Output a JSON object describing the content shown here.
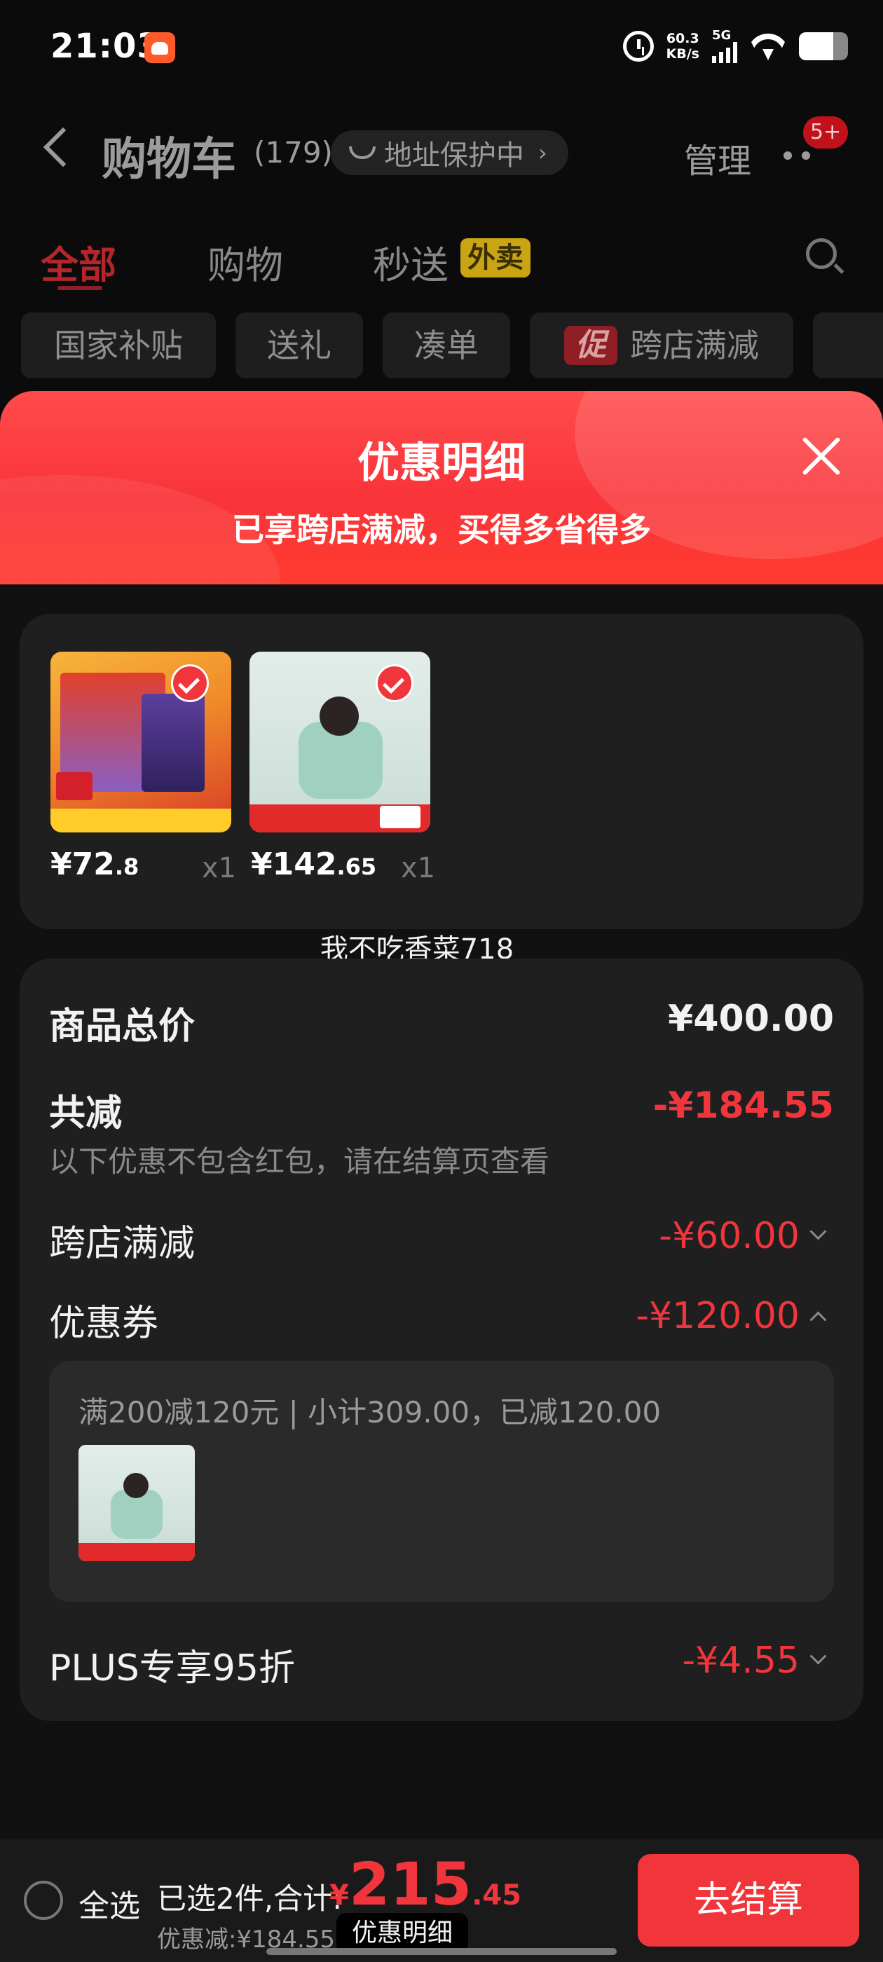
{
  "status_bar": {
    "time": "21:03",
    "net_speed_value": "60.3",
    "net_speed_unit": "KB/s",
    "network_type": "5G",
    "battery_level": 0.7
  },
  "header": {
    "title": "购物车",
    "count": "(179)",
    "address_protect": "地址保护中",
    "manage": "管理",
    "notification_badge": "5+"
  },
  "tabs": [
    {
      "label": "全部",
      "active": true
    },
    {
      "label": "购物",
      "active": false
    },
    {
      "label": "秒送",
      "active": false
    }
  ],
  "waimai_tag": "外卖",
  "filters": {
    "chips": [
      "国家补贴",
      "送礼",
      "凑单"
    ],
    "promo_tag": "促",
    "promo_chip": "跨店满减"
  },
  "sheet": {
    "title": "优惠明细",
    "subtitle": "已享跨店满减，买得多省得多"
  },
  "products": [
    {
      "price_int": "¥72",
      "price_dec": ".8",
      "qty": "x1"
    },
    {
      "price_int": "¥142",
      "price_dec": ".65",
      "qty": "x1"
    }
  ],
  "watermark": "我不吃香菜718",
  "summary": {
    "total_label": "商品总价",
    "total_value": "¥400.00",
    "reduce_label": "共减",
    "reduce_value": "-¥184.55",
    "note": "以下优惠不包含红包，请在结算页查看",
    "cross_store_label": "跨店满减",
    "cross_store_value": "-¥60.00",
    "coupon_label": "优惠券",
    "coupon_value": "-¥120.00",
    "coupon_detail": "满200减120元 | 小计309.00，已减120.00",
    "plus_label": "PLUS专享95折",
    "plus_value": "-¥4.55"
  },
  "bottom_bar": {
    "select_all": "全选",
    "selected": "已选2件,合计:",
    "currency": "¥",
    "total_int": "215",
    "total_dec": ".45",
    "discount": "优惠减:¥184.55",
    "detail_button": "优惠明细",
    "checkout": "去结算"
  },
  "colors": {
    "accent_red": "#f0363c",
    "background": "#0b0b0b",
    "card": "#1f1f1f"
  }
}
